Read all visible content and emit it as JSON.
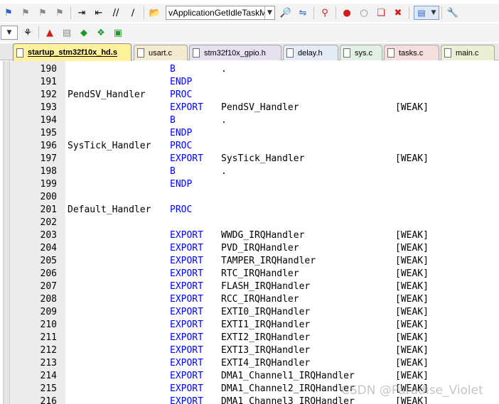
{
  "toolbar1": {
    "function_combo_value": "vApplicationGetIdleTaskM"
  },
  "tabs": [
    {
      "label": "startup_stm32f10x_hd.s",
      "active": true,
      "color": "#fff29a"
    },
    {
      "label": "usart.c",
      "active": false,
      "color": "#f3ebcf"
    },
    {
      "label": "stm32f10x_gpio.h",
      "active": false,
      "color": "#e7e0f1"
    },
    {
      "label": "delay.h",
      "active": false,
      "color": "#e3ebf7"
    },
    {
      "label": "sys.c",
      "active": false,
      "color": "#e3f1e5"
    },
    {
      "label": "tasks.c",
      "active": false,
      "color": "#f6dede"
    },
    {
      "label": "main.c",
      "active": false,
      "color": "#ecefd2"
    }
  ],
  "code_lines": [
    {
      "n": "190",
      "label": "",
      "instr": "B",
      "operand": ".",
      "attr": ""
    },
    {
      "n": "191",
      "label": "",
      "instr": "ENDP",
      "operand": "",
      "attr": ""
    },
    {
      "n": "192",
      "label": "PendSV_Handler",
      "instr": "PROC",
      "operand": "",
      "attr": ""
    },
    {
      "n": "193",
      "label": "",
      "instr": "EXPORT",
      "operand": "PendSV_Handler",
      "attr": "[WEAK]"
    },
    {
      "n": "194",
      "label": "",
      "instr": "B",
      "operand": ".",
      "attr": ""
    },
    {
      "n": "195",
      "label": "",
      "instr": "ENDP",
      "operand": "",
      "attr": ""
    },
    {
      "n": "196",
      "label": "SysTick_Handler",
      "instr": "PROC",
      "operand": "",
      "attr": ""
    },
    {
      "n": "197",
      "label": "",
      "instr": "EXPORT",
      "operand": "SysTick_Handler",
      "attr": "[WEAK]"
    },
    {
      "n": "198",
      "label": "",
      "instr": "B",
      "operand": ".",
      "attr": ""
    },
    {
      "n": "199",
      "label": "",
      "instr": "ENDP",
      "operand": "",
      "attr": ""
    },
    {
      "n": "200",
      "label": "",
      "instr": "",
      "operand": "",
      "attr": ""
    },
    {
      "n": "201",
      "label": "Default_Handler",
      "instr": "PROC",
      "operand": "",
      "attr": ""
    },
    {
      "n": "202",
      "label": "",
      "instr": "",
      "operand": "",
      "attr": ""
    },
    {
      "n": "203",
      "label": "",
      "instr": "EXPORT",
      "operand": "WWDG_IRQHandler",
      "attr": "[WEAK]"
    },
    {
      "n": "204",
      "label": "",
      "instr": "EXPORT",
      "operand": "PVD_IRQHandler",
      "attr": "[WEAK]"
    },
    {
      "n": "205",
      "label": "",
      "instr": "EXPORT",
      "operand": "TAMPER_IRQHandler",
      "attr": "[WEAK]"
    },
    {
      "n": "206",
      "label": "",
      "instr": "EXPORT",
      "operand": "RTC_IRQHandler",
      "attr": "[WEAK]"
    },
    {
      "n": "207",
      "label": "",
      "instr": "EXPORT",
      "operand": "FLASH_IRQHandler",
      "attr": "[WEAK]"
    },
    {
      "n": "208",
      "label": "",
      "instr": "EXPORT",
      "operand": "RCC_IRQHandler",
      "attr": "[WEAK]"
    },
    {
      "n": "209",
      "label": "",
      "instr": "EXPORT",
      "operand": "EXTI0_IRQHandler",
      "attr": "[WEAK]"
    },
    {
      "n": "210",
      "label": "",
      "instr": "EXPORT",
      "operand": "EXTI1_IRQHandler",
      "attr": "[WEAK]"
    },
    {
      "n": "211",
      "label": "",
      "instr": "EXPORT",
      "operand": "EXTI2_IRQHandler",
      "attr": "[WEAK]"
    },
    {
      "n": "212",
      "label": "",
      "instr": "EXPORT",
      "operand": "EXTI3_IRQHandler",
      "attr": "[WEAK]"
    },
    {
      "n": "213",
      "label": "",
      "instr": "EXPORT",
      "operand": "EXTI4_IRQHandler",
      "attr": "[WEAK]"
    },
    {
      "n": "214",
      "label": "",
      "instr": "EXPORT",
      "operand": "DMA1_Channel1_IRQHandler",
      "attr": "[WEAK]"
    },
    {
      "n": "215",
      "label": "",
      "instr": "EXPORT",
      "operand": "DMA1_Channel2_IRQHandler",
      "attr": "[WEAK]"
    },
    {
      "n": "216",
      "label": "",
      "instr": "EXPORT",
      "operand": "DMA1_Channel3_IRQHandler",
      "attr": "[WEAK]"
    }
  ],
  "colors": {
    "keyword": "#0000ff",
    "active_tab": "#fff29a",
    "gutter": "#ececec"
  },
  "watermark": "CSDN @Paradise_Violet"
}
